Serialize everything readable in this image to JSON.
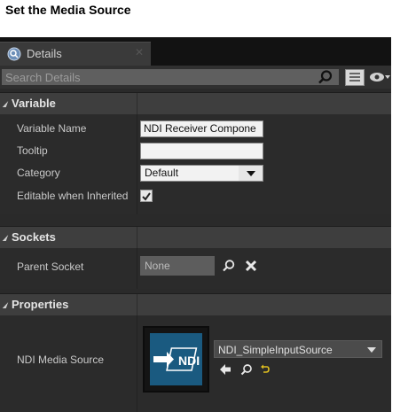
{
  "page": {
    "heading": "Set the Media Source"
  },
  "tab": {
    "label": "Details",
    "close": "✕"
  },
  "search": {
    "placeholder": "Search Details"
  },
  "sections": {
    "variable": {
      "title": "Variable"
    },
    "sockets": {
      "title": "Sockets"
    },
    "properties": {
      "title": "Properties"
    }
  },
  "variable": {
    "name_label": "Variable Name",
    "name_value": "NDI Receiver Compone",
    "tooltip_label": "Tooltip",
    "tooltip_value": "",
    "category_label": "Category",
    "category_value": "Default",
    "editable_label": "Editable when Inherited",
    "editable_checked": true
  },
  "sockets": {
    "parent_label": "Parent Socket",
    "parent_value": "None"
  },
  "properties": {
    "ndi_label": "NDI Media Source",
    "asset_value": "NDI_SimpleInputSource",
    "thumbnail_text": "NDI"
  },
  "colors": {
    "panel_bg": "#2a2a2a",
    "section_bg": "#3e3e3e",
    "thumbnail_bg": "#1a5a80",
    "browse_icon": "#e0c020"
  }
}
